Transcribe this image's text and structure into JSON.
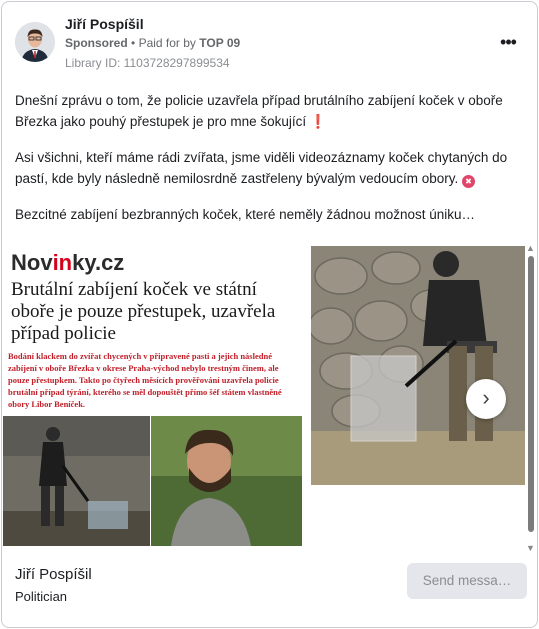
{
  "header": {
    "advertiser_name": "Jiří Pospíšil",
    "sponsored_label": "Sponsored",
    "separator": "•",
    "paid_for_prefix": "Paid for by",
    "paid_for_by": "TOP 09",
    "library_id": "Library ID: 1103728297899534",
    "more_icon": "more-options-icon",
    "more_label": "•••"
  },
  "post": {
    "paragraph1": "Dnešní zprávu o tom, že policie uzavřela případ brutálního zabíjení koček v oboře Březka jako pouhý přestupek je pro mne šokující",
    "paragraph1_emoji": "❗",
    "paragraph2": "Asi všichni, kteří máme rádi zvířata, jsme viděli videozáznamy koček chytaných do pastí, kde byly následně nemilosrdně zastřeleny bývalým vedoucím obory.",
    "paragraph2_emoji_icon": "angry-face-icon",
    "paragraph3": "Bezcitné zabíjení bezbranných koček, které neměly žádnou možnost úniku…"
  },
  "carousel": {
    "slide1": {
      "logo_part1": "Nov",
      "logo_part2": "in",
      "logo_part3": "ky.cz",
      "headline": "Brutální zabíjení koček ve státní oboře je pouze přestupek, uzavřela případ policie",
      "lead": "Bodání klackem do zvířat chycených v připravené pasti a jejich následné zabíjení v oboře Březka v okrese Praha-východ nebylo trestným činem, ale pouze přestupkem. Takto po čtyřech měsících prověřování uzavřela policie brutální případ týrání, kterého se měl dopouštět přímo šéf státem vlastněné obory Libor Beníček."
    },
    "next_icon": "chevron-right-icon",
    "next_label": "›"
  },
  "scrollbar": {
    "up_label": "▲",
    "down_label": "▼"
  },
  "footer": {
    "name": "Jiří Pospíšil",
    "role": "Politician",
    "send_button": "Send messa…"
  }
}
